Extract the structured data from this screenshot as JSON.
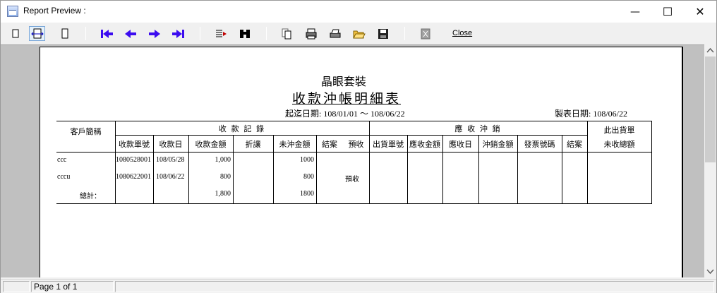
{
  "window": {
    "title": "Report Preview :"
  },
  "window_controls": {
    "minimize": "—",
    "maximize": "☐",
    "close": "✕"
  },
  "toolbar": {
    "close_label": "Close"
  },
  "report": {
    "company": "晶眼套裝",
    "title": "收款沖帳明細表",
    "date_range": "起迄日期: 108/01/01 ～ 108/06/22",
    "made_date": "製表日期: 108/06/22",
    "group_receipt": "收 款 記 錄",
    "group_offset": "應 收 沖 銷",
    "col_customer": "客戶簡稱",
    "col_unpaid_line1": "此出貨單",
    "col_unpaid_line2": "未收總額",
    "columns": [
      "收款單號",
      "收款日",
      "收款金額",
      "折讓",
      "未沖金額",
      "結案",
      "預收",
      "出貨單號",
      "應收金額",
      "應收日",
      "沖銷金額",
      "發票號碼",
      "結案"
    ],
    "rows": [
      {
        "customer": "ccc",
        "receipt_no": "1080528001",
        "date": "108/05/28",
        "amount": "1,000",
        "discount": "",
        "unoffset": "1000",
        "closed": "",
        "advance": ""
      },
      {
        "customer": "cccu",
        "receipt_no": "1080622001",
        "date": "108/06/22",
        "amount": "800",
        "discount": "",
        "unoffset": "800",
        "closed": "",
        "advance": "預收"
      }
    ],
    "total": {
      "label": "總計：",
      "amount": "1,800",
      "unoffset": "1800"
    }
  },
  "status": {
    "page": "Page 1 of 1"
  }
}
